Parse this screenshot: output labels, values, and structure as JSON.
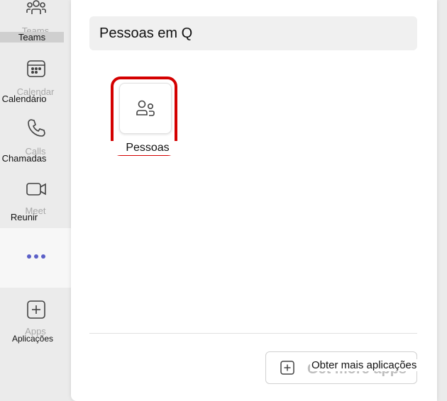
{
  "rail": {
    "items": [
      {
        "id": "teams",
        "ghost": "Teams",
        "label": "Teams",
        "icon": "people-team-icon"
      },
      {
        "id": "calendar",
        "ghost": "Calendar",
        "label": "Calendário",
        "icon": "calendar-icon"
      },
      {
        "id": "calls",
        "ghost": "Calls",
        "label": "Chamadas",
        "icon": "phone-icon"
      },
      {
        "id": "meet",
        "ghost": "Meet",
        "label": "Reunir",
        "icon": "video-icon"
      },
      {
        "id": "more",
        "icon": "more-dots-icon",
        "selected": true
      },
      {
        "id": "apps",
        "ghost": "Apps",
        "label": "Aplicações",
        "icon": "add-square-icon"
      }
    ]
  },
  "search": {
    "value": "Pessoas em Q"
  },
  "app_tile": {
    "label": "Pessoas",
    "icon": "people-icon",
    "highlight_color": "#d40000"
  },
  "footer": {
    "get_apps_ghost": "Get more apps",
    "get_apps_label": "Obter mais aplicações",
    "icon": "add-square-icon"
  },
  "colors": {
    "accent": "#5b5fc7",
    "rail_bg": "#ebebeb",
    "panel_bg": "#ffffff"
  }
}
